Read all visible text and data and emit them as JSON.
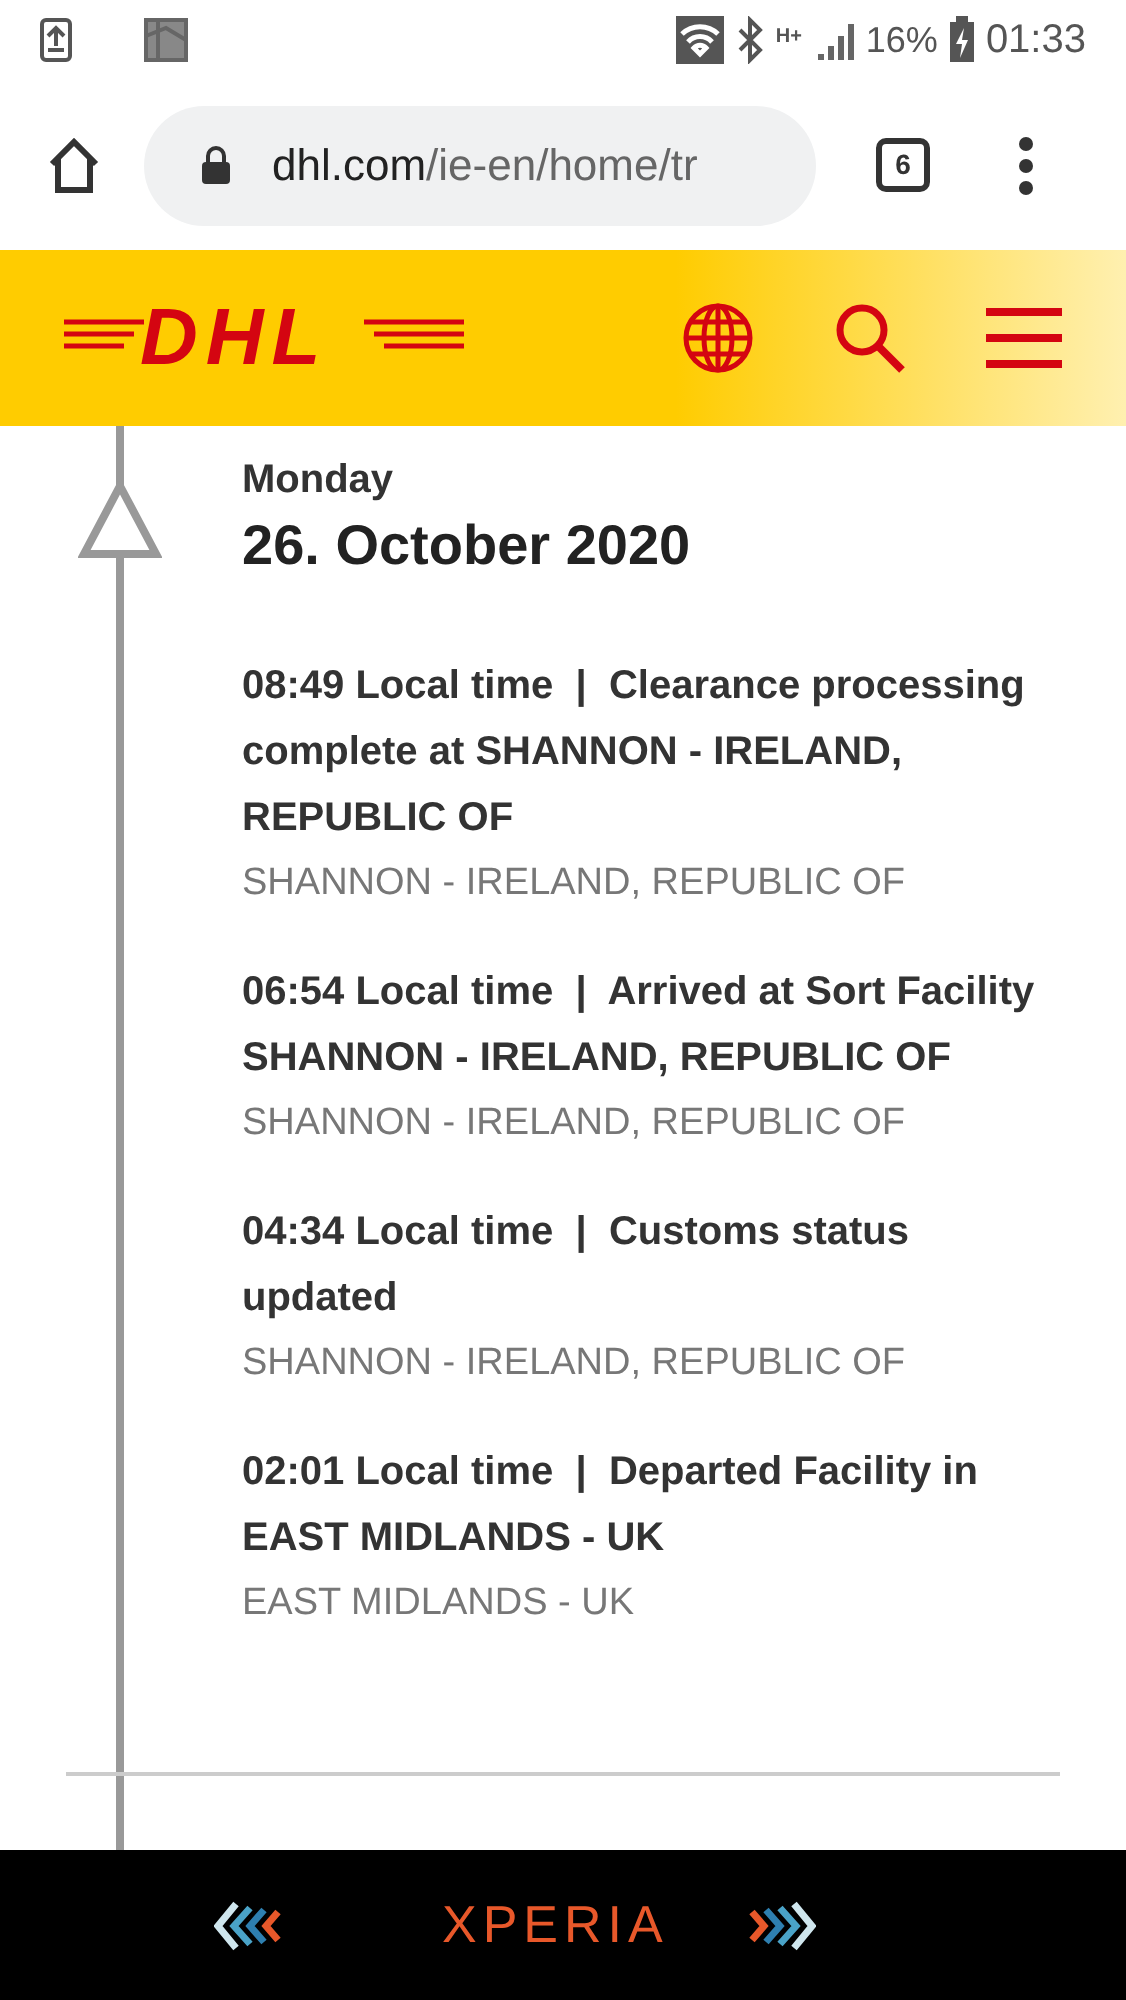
{
  "status_bar": {
    "battery": "16%",
    "time": "01:33",
    "network": "H+"
  },
  "browser": {
    "url_domain": "dhl.com",
    "url_path": "/ie-en/home/tr",
    "tab_count": "6"
  },
  "header": {
    "logo": "DHL"
  },
  "day": {
    "weekday": "Monday",
    "date": "26. October 2020"
  },
  "events": [
    {
      "text": "08:49 Local time  |  Clearance processing complete at SHANNON - IRELAND, REPUBLIC OF",
      "location": "SHANNON - IRELAND, REPUBLIC OF"
    },
    {
      "text": "06:54 Local time  |  Arrived at Sort Facility SHANNON - IRELAND, REPUBLIC OF",
      "location": "SHANNON - IRELAND, REPUBLIC OF"
    },
    {
      "text": "04:34 Local time  |  Customs status updated",
      "location": "SHANNON - IRELAND, REPUBLIC OF"
    },
    {
      "text": "02:01 Local time  |  Departed Facility in EAST MIDLANDS - UK",
      "location": "EAST MIDLANDS - UK"
    }
  ],
  "nav_bar": {
    "brand": "XPERIA"
  }
}
